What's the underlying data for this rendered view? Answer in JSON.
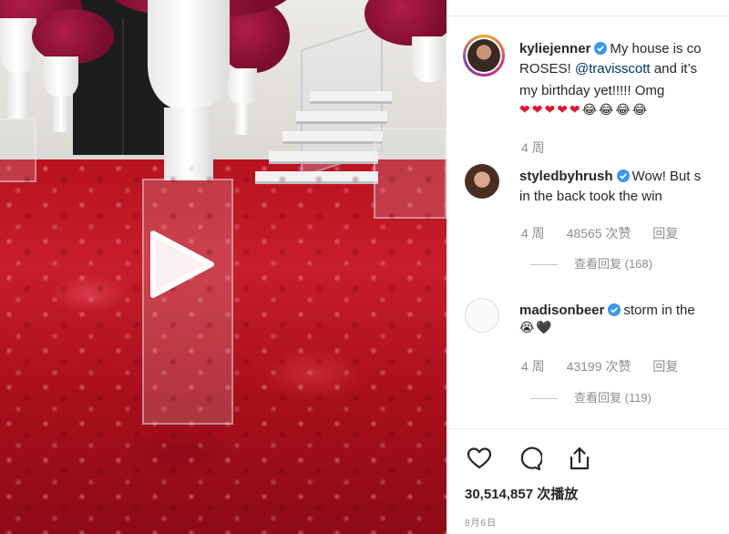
{
  "post": {
    "username": "kyliejenner",
    "caption_line1": "My house is co",
    "caption_line2_pre": "ROSES! ",
    "caption_mention": "@travisscott",
    "caption_line2_post": " and it’s",
    "caption_line3": "my birthday yet!!!!! Omg",
    "caption_hearts": "❤❤❤❤❤",
    "caption_cry": "😂😂😂😂",
    "time": "4 周"
  },
  "comments": [
    {
      "username": "styledbyhrush",
      "text_line1": "Wow! But s",
      "text_line2": "in the back took the win",
      "time": "4 周",
      "likes": "48565 次赞",
      "reply_label": "回复",
      "view_replies": "查看回复 (168)"
    },
    {
      "username": "madisonbeer",
      "text_line1": "storm in the",
      "text_emoji": "😭🖤",
      "time": "4 周",
      "likes": "43199 次赞",
      "reply_label": "回复",
      "view_replies": "查看回复 (119)"
    }
  ],
  "actions": {
    "like_icon": "heart-icon",
    "comment_icon": "comment-icon",
    "share_icon": "share-icon"
  },
  "stats": {
    "views": "30,514,857 次播放",
    "date": "8月6日"
  },
  "colors": {
    "verified": "#3897f0",
    "mention": "#003569",
    "meta_text": "#8e8e8e"
  }
}
